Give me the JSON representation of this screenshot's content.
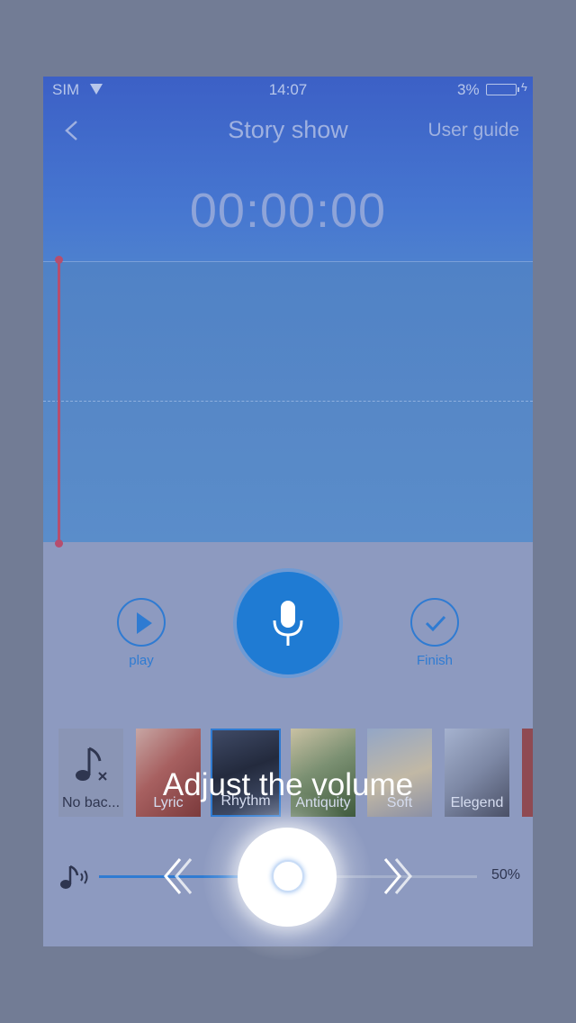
{
  "status": {
    "carrier": "SIM",
    "time": "14:07",
    "battery": "3%"
  },
  "nav": {
    "title": "Story show",
    "user_guide": "User guide"
  },
  "timer": "00:00:00",
  "controls": {
    "play_label": "play",
    "finish_label": "Finish"
  },
  "music": {
    "items": [
      {
        "label": "No bac...",
        "icon": "note-off-icon"
      },
      {
        "label": "Lyric"
      },
      {
        "label": "Rhythm",
        "selected": true
      },
      {
        "label": "Antiquity"
      },
      {
        "label": "Soft"
      },
      {
        "label": "Elegend"
      }
    ]
  },
  "volume": {
    "value_label": "50%",
    "level": 0.5
  },
  "guide": {
    "text": "Adjust the volume"
  },
  "colors": {
    "accent": "#2f7bd2",
    "playhead": "#b64e6e",
    "header": "#3c60c6"
  }
}
